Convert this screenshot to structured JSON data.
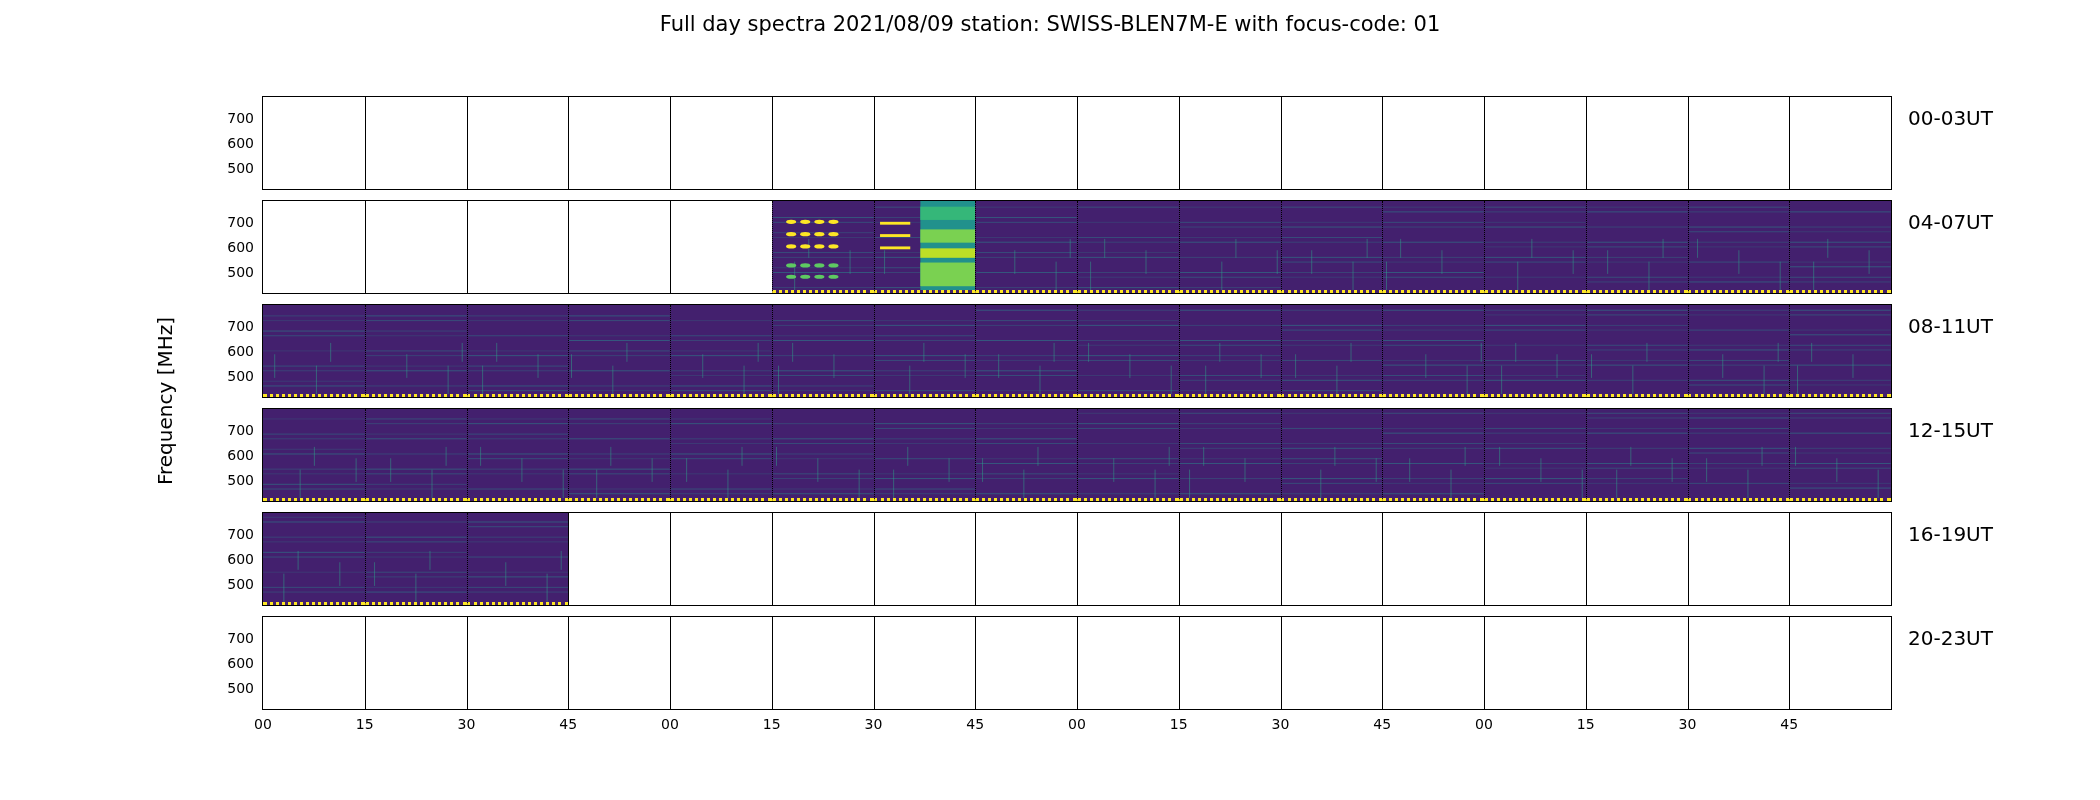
{
  "title": "Full day spectra 2021/08/09 station: SWISS-BLEN7M-E with focus-code: 01",
  "ylabel": "Frequency [MHz]",
  "rows": [
    {
      "label": "00-03UT",
      "yticks": [
        "700",
        "600",
        "500"
      ],
      "panels": [
        {
          "kind": "empty"
        },
        {
          "kind": "empty"
        },
        {
          "kind": "empty"
        },
        {
          "kind": "empty"
        },
        {
          "kind": "empty"
        },
        {
          "kind": "empty"
        },
        {
          "kind": "empty"
        },
        {
          "kind": "empty"
        },
        {
          "kind": "empty"
        },
        {
          "kind": "empty"
        },
        {
          "kind": "empty"
        },
        {
          "kind": "empty"
        },
        {
          "kind": "empty"
        },
        {
          "kind": "empty"
        },
        {
          "kind": "empty"
        },
        {
          "kind": "empty"
        }
      ]
    },
    {
      "label": "04-07UT",
      "yticks": [
        "700",
        "600",
        "500"
      ],
      "panels": [
        {
          "kind": "empty"
        },
        {
          "kind": "empty"
        },
        {
          "kind": "empty"
        },
        {
          "kind": "empty"
        },
        {
          "kind": "empty"
        },
        {
          "kind": "rfi_burst"
        },
        {
          "kind": "rfi_band"
        },
        {
          "kind": "spectrogram"
        },
        {
          "kind": "spectrogram"
        },
        {
          "kind": "spectrogram"
        },
        {
          "kind": "spectrogram"
        },
        {
          "kind": "spectrogram"
        },
        {
          "kind": "spectrogram"
        },
        {
          "kind": "spectrogram"
        },
        {
          "kind": "spectrogram"
        },
        {
          "kind": "spectrogram"
        }
      ]
    },
    {
      "label": "08-11UT",
      "yticks": [
        "700",
        "600",
        "500"
      ],
      "panels": [
        {
          "kind": "spectrogram"
        },
        {
          "kind": "spectrogram"
        },
        {
          "kind": "spectrogram"
        },
        {
          "kind": "spectrogram"
        },
        {
          "kind": "spectrogram"
        },
        {
          "kind": "spectrogram"
        },
        {
          "kind": "spectrogram"
        },
        {
          "kind": "spectrogram"
        },
        {
          "kind": "spectrogram"
        },
        {
          "kind": "spectrogram"
        },
        {
          "kind": "spectrogram"
        },
        {
          "kind": "spectrogram"
        },
        {
          "kind": "spectrogram"
        },
        {
          "kind": "spectrogram"
        },
        {
          "kind": "spectrogram"
        },
        {
          "kind": "spectrogram"
        }
      ]
    },
    {
      "label": "12-15UT",
      "yticks": [
        "700",
        "600",
        "500"
      ],
      "panels": [
        {
          "kind": "spectrogram"
        },
        {
          "kind": "spectrogram"
        },
        {
          "kind": "spectrogram"
        },
        {
          "kind": "spectrogram"
        },
        {
          "kind": "spectrogram"
        },
        {
          "kind": "spectrogram"
        },
        {
          "kind": "spectrogram"
        },
        {
          "kind": "spectrogram"
        },
        {
          "kind": "spectrogram"
        },
        {
          "kind": "spectrogram"
        },
        {
          "kind": "spectrogram"
        },
        {
          "kind": "spectrogram"
        },
        {
          "kind": "spectrogram"
        },
        {
          "kind": "spectrogram"
        },
        {
          "kind": "spectrogram"
        },
        {
          "kind": "spectrogram"
        }
      ]
    },
    {
      "label": "16-19UT",
      "yticks": [
        "700",
        "600",
        "500"
      ],
      "panels": [
        {
          "kind": "spectrogram"
        },
        {
          "kind": "spectrogram"
        },
        {
          "kind": "spectrogram"
        },
        {
          "kind": "empty"
        },
        {
          "kind": "empty"
        },
        {
          "kind": "empty"
        },
        {
          "kind": "empty"
        },
        {
          "kind": "empty"
        },
        {
          "kind": "empty"
        },
        {
          "kind": "empty"
        },
        {
          "kind": "empty"
        },
        {
          "kind": "empty"
        },
        {
          "kind": "empty"
        },
        {
          "kind": "empty"
        },
        {
          "kind": "empty"
        },
        {
          "kind": "empty"
        }
      ]
    },
    {
      "label": "20-23UT",
      "yticks": [
        "700",
        "600",
        "500"
      ],
      "panels": [
        {
          "kind": "empty"
        },
        {
          "kind": "empty"
        },
        {
          "kind": "empty"
        },
        {
          "kind": "empty"
        },
        {
          "kind": "empty"
        },
        {
          "kind": "empty"
        },
        {
          "kind": "empty"
        },
        {
          "kind": "empty"
        },
        {
          "kind": "empty"
        },
        {
          "kind": "empty"
        },
        {
          "kind": "empty"
        },
        {
          "kind": "empty"
        },
        {
          "kind": "empty"
        },
        {
          "kind": "empty"
        },
        {
          "kind": "empty"
        },
        {
          "kind": "empty"
        }
      ]
    }
  ],
  "xticks": [
    "00",
    "15",
    "30",
    "45",
    "00",
    "15",
    "30",
    "45",
    "00",
    "15",
    "30",
    "45",
    "00",
    "15",
    "30",
    "45"
  ]
}
